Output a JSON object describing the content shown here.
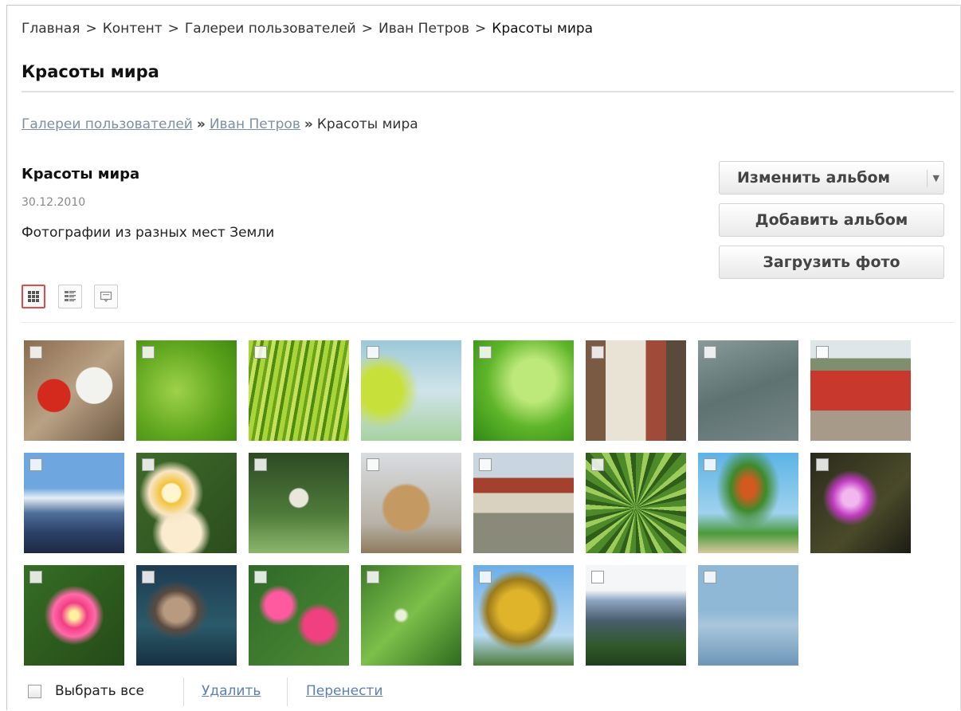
{
  "admin_breadcrumbs": {
    "items": [
      "Главная",
      "Контент",
      "Галереи пользователей",
      "Иван Петров"
    ],
    "current": "Красоты мира",
    "separator": ">"
  },
  "page_title": "Красоты мира",
  "gallery_breadcrumbs": {
    "items": [
      "Галереи пользователей",
      "Иван Петров"
    ],
    "current": "Красоты мира",
    "separator": "»"
  },
  "album": {
    "name": "Красоты мира",
    "date": "30.12.2010",
    "description": "Фотографии из разных мест Земли"
  },
  "buttons": {
    "edit_album": "Изменить альбом",
    "add_album": "Добавить альбом",
    "upload_photo": "Загрузить фото"
  },
  "view_modes": [
    "grid-view-icon",
    "list-view-icon",
    "detail-view-icon"
  ],
  "photos": [
    {
      "subject": "red poppy and white flowers"
    },
    {
      "subject": "green leaf macro"
    },
    {
      "subject": "green grass blades"
    },
    {
      "subject": "leaves on blue sky"
    },
    {
      "subject": "leaf with water drop"
    },
    {
      "subject": "old town street"
    },
    {
      "subject": "water surface"
    },
    {
      "subject": "red flowers field"
    },
    {
      "subject": "snowy mountains"
    },
    {
      "subject": "frangipani flowers"
    },
    {
      "subject": "japanese garden"
    },
    {
      "subject": "buddha statue"
    },
    {
      "subject": "temple"
    },
    {
      "subject": "agave plant"
    },
    {
      "subject": "tree by the sea"
    },
    {
      "subject": "pink water lily"
    },
    {
      "subject": "pink adenium flower"
    },
    {
      "subject": "lionfish"
    },
    {
      "subject": "pink flowers bunch"
    },
    {
      "subject": "green plants"
    },
    {
      "subject": "yellow autumn tree"
    },
    {
      "subject": "mountain peaks"
    },
    {
      "subject": "misty sea horizon"
    }
  ],
  "footer": {
    "select_all": "Выбрать все",
    "delete": "Удалить",
    "move": "Перенести"
  },
  "colors": {
    "accent_active": "#e24a4a",
    "link": "#5b7fb6",
    "muted_link": "#7f8ea5"
  }
}
